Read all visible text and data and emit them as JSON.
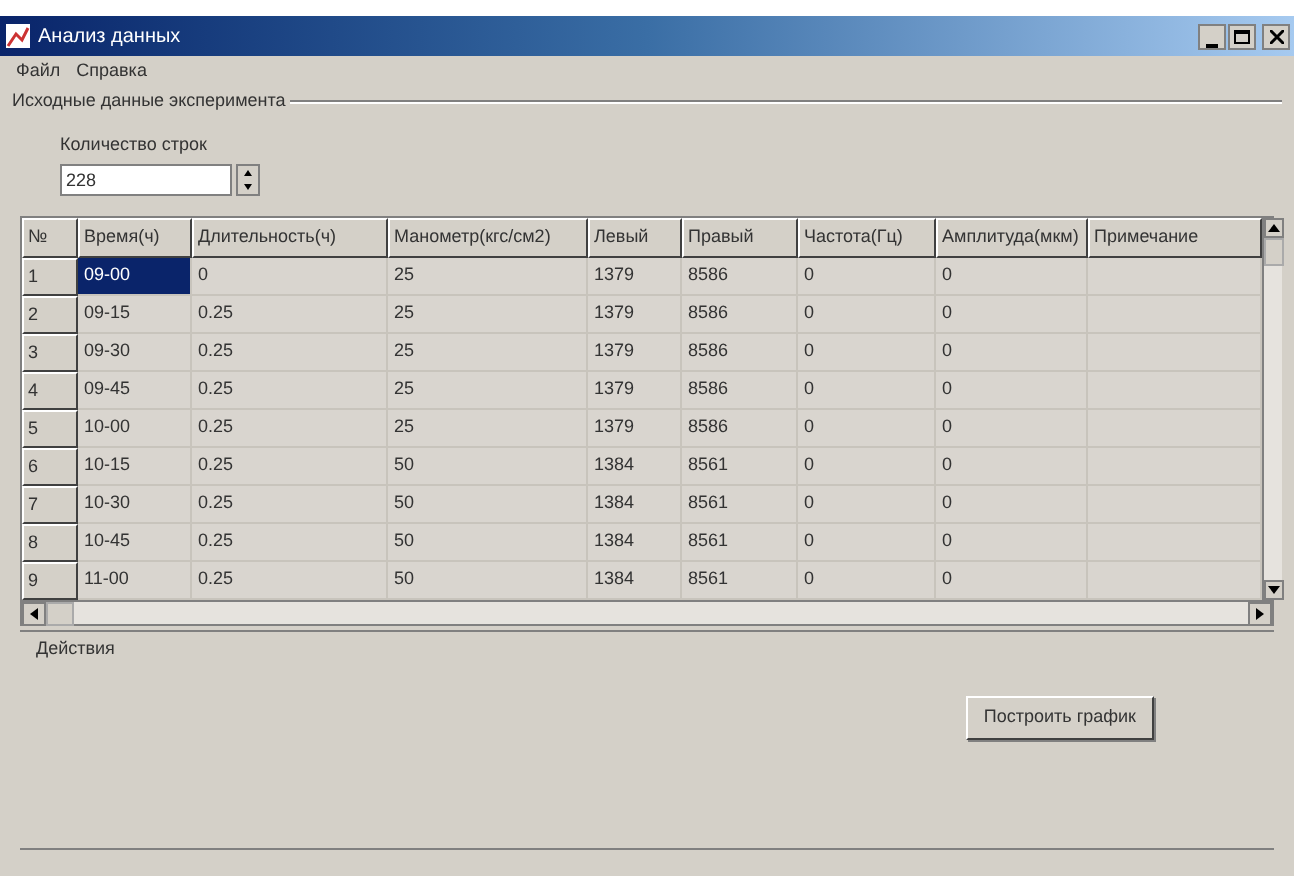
{
  "window": {
    "title": "Анализ данных"
  },
  "menu": [
    "Файл",
    "Справка"
  ],
  "source_group": {
    "title": "Исходные данные эксперимента",
    "rows_label": "Количество строк",
    "rows_value": "228"
  },
  "table": {
    "corner": "№",
    "columns": [
      "Время(ч)",
      "Длительность(ч)",
      "Манометр(кгс/см2)",
      "Левый",
      "Правый",
      "Частота(Гц)",
      "Амплитуда(мкм)",
      "Примечание"
    ],
    "rows": [
      {
        "number": "1",
        "cells": [
          {
            "text": "09-00",
            "selected": true
          },
          {
            "text": "0",
            "selected": false
          },
          {
            "text": "25",
            "selected": false
          },
          {
            "text": "1379",
            "selected": false
          },
          {
            "text": "8586",
            "selected": false
          },
          {
            "text": "0",
            "selected": false
          },
          {
            "text": "0",
            "selected": false
          }
        ]
      },
      {
        "number": "2",
        "cells": [
          {
            "text": "09-15",
            "selected": false
          },
          {
            "text": "0.25",
            "selected": false
          },
          {
            "text": "25",
            "selected": false
          },
          {
            "text": "1379",
            "selected": false
          },
          {
            "text": "8586",
            "selected": false
          },
          {
            "text": "0",
            "selected": false
          },
          {
            "text": "0",
            "selected": false
          }
        ]
      },
      {
        "number": "3",
        "cells": [
          {
            "text": "09-30",
            "selected": false
          },
          {
            "text": "0.25",
            "selected": false
          },
          {
            "text": "25",
            "selected": false
          },
          {
            "text": "1379",
            "selected": false
          },
          {
            "text": "8586",
            "selected": false
          },
          {
            "text": "0",
            "selected": false
          },
          {
            "text": "0",
            "selected": false
          }
        ]
      },
      {
        "number": "4",
        "cells": [
          {
            "text": "09-45",
            "selected": false
          },
          {
            "text": "0.25",
            "selected": false
          },
          {
            "text": "25",
            "selected": false
          },
          {
            "text": "1379",
            "selected": false
          },
          {
            "text": "8586",
            "selected": false
          },
          {
            "text": "0",
            "selected": false
          },
          {
            "text": "0",
            "selected": false
          }
        ]
      },
      {
        "number": "5",
        "cells": [
          {
            "text": "10-00",
            "selected": false
          },
          {
            "text": "0.25",
            "selected": false
          },
          {
            "text": "25",
            "selected": false
          },
          {
            "text": "1379",
            "selected": false
          },
          {
            "text": "8586",
            "selected": false
          },
          {
            "text": "0",
            "selected": false
          },
          {
            "text": "0",
            "selected": false
          }
        ]
      },
      {
        "number": "6",
        "cells": [
          {
            "text": "10-15",
            "selected": false
          },
          {
            "text": "0.25",
            "selected": false
          },
          {
            "text": "50",
            "selected": false
          },
          {
            "text": "1384",
            "selected": false
          },
          {
            "text": "8561",
            "selected": false
          },
          {
            "text": "0",
            "selected": false
          },
          {
            "text": "0",
            "selected": false
          }
        ]
      },
      {
        "number": "7",
        "cells": [
          {
            "text": "10-30",
            "selected": false
          },
          {
            "text": "0.25",
            "selected": false
          },
          {
            "text": "50",
            "selected": false
          },
          {
            "text": "1384",
            "selected": false
          },
          {
            "text": "8561",
            "selected": false
          },
          {
            "text": "0",
            "selected": false
          },
          {
            "text": "0",
            "selected": false
          }
        ]
      },
      {
        "number": "8",
        "cells": [
          {
            "text": "10-45",
            "selected": false
          },
          {
            "text": "0.25",
            "selected": false
          },
          {
            "text": "50",
            "selected": false
          },
          {
            "text": "1384",
            "selected": false
          },
          {
            "text": "8561",
            "selected": false
          },
          {
            "text": "0",
            "selected": false
          },
          {
            "text": "0",
            "selected": false
          }
        ]
      },
      {
        "number": "9",
        "cells": [
          {
            "text": "11-00",
            "selected": false
          },
          {
            "text": "0.25",
            "selected": false
          },
          {
            "text": "50",
            "selected": false
          },
          {
            "text": "1384",
            "selected": false
          },
          {
            "text": "8561",
            "selected": false
          },
          {
            "text": "0",
            "selected": false
          },
          {
            "text": "0",
            "selected": false
          }
        ]
      }
    ]
  },
  "actions_group": {
    "title": "Действия",
    "buttons": [
      "Построить график"
    ]
  }
}
